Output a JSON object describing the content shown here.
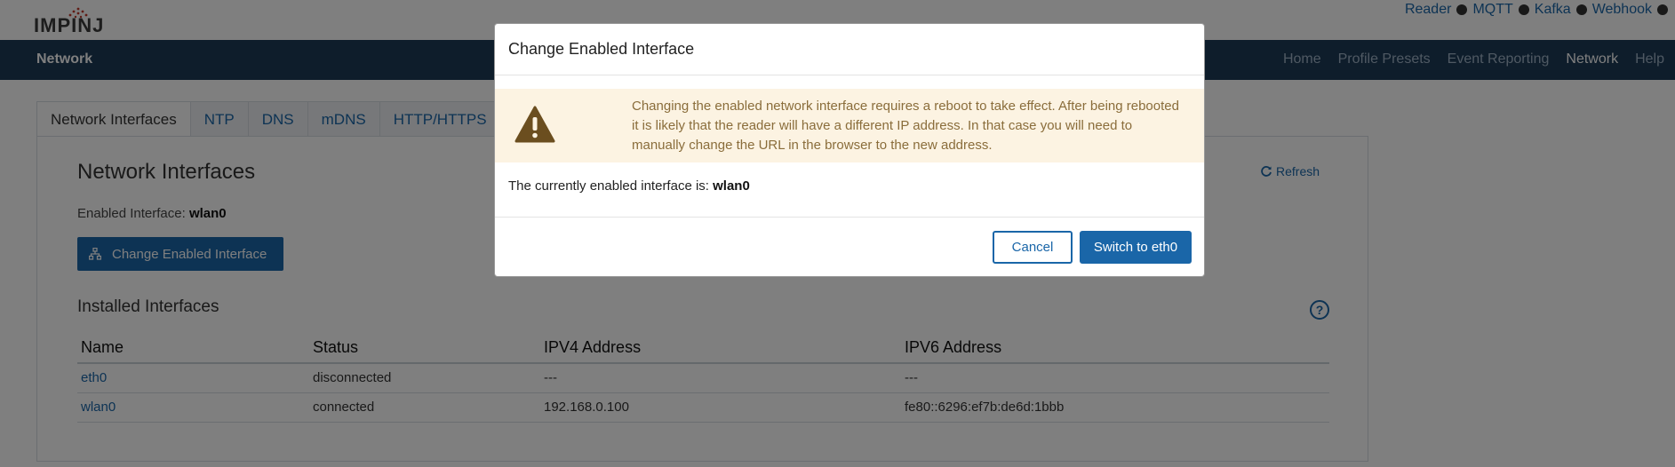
{
  "brand": {
    "logo_text": "IMPINJ",
    "navbar_title": "Network"
  },
  "top_links": [
    "Reader",
    "MQTT",
    "Kafka",
    "Webhook"
  ],
  "nav": {
    "items": [
      {
        "label": "Home",
        "active": false
      },
      {
        "label": "Profile Presets",
        "active": false
      },
      {
        "label": "Event Reporting",
        "active": false
      },
      {
        "label": "Network",
        "active": true
      },
      {
        "label": "Help",
        "active": false
      }
    ]
  },
  "tabs": [
    {
      "label": "Network Interfaces",
      "active": true
    },
    {
      "label": "NTP",
      "active": false
    },
    {
      "label": "DNS",
      "active": false
    },
    {
      "label": "mDNS",
      "active": false
    },
    {
      "label": "HTTP/HTTPS",
      "active": false
    }
  ],
  "panel": {
    "title": "Network Interfaces",
    "refresh_label": "Refresh",
    "enabled_label": "Enabled Interface:",
    "enabled_value": "wlan0",
    "change_button": "Change Enabled Interface",
    "installed_title": "Installed Interfaces",
    "help_glyph": "?"
  },
  "table": {
    "columns": [
      "Name",
      "Status",
      "IPV4 Address",
      "IPV6 Address"
    ],
    "rows": [
      [
        "eth0",
        "disconnected",
        "---",
        "---"
      ],
      [
        "wlan0",
        "connected",
        "192.168.0.100",
        "fe80::6296:ef7b:de6d:1bbb"
      ]
    ]
  },
  "modal": {
    "title": "Change Enabled Interface",
    "warning": "Changing the enabled network interface requires a reboot to take effect. After being rebooted it is likely that the reader will have a different IP address. In that case you will need to manually change the URL in the browser to the new address.",
    "current_label": "The currently enabled interface is:",
    "current_value": "wlan0",
    "cancel_label": "Cancel",
    "switch_label": "Switch to eth0"
  },
  "colors": {
    "navbar": "#1c3a57",
    "accent": "#1a66a8",
    "warning_bg": "#fcf3e2",
    "warning_text": "#8a6d3b",
    "warning_icon": "#6b4e1f"
  }
}
